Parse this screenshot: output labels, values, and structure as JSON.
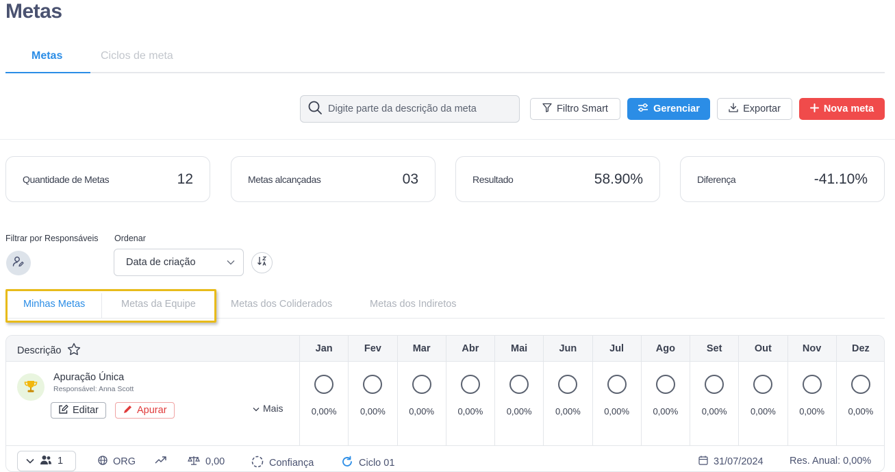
{
  "page": {
    "title": "Metas"
  },
  "top_tabs": [
    {
      "label": "Metas",
      "active": true
    },
    {
      "label": "Ciclos de meta",
      "active": false
    }
  ],
  "toolbar": {
    "search_placeholder": "Digite parte da descrição da meta",
    "filter_label": "Filtro Smart",
    "manage_label": "Gerenciar",
    "export_label": "Exportar",
    "new_label": "Nova meta"
  },
  "stats": [
    {
      "label": "Quantidade de Metas",
      "value": "12"
    },
    {
      "label": "Metas alcançadas",
      "value": "03"
    },
    {
      "label": "Resultado",
      "value": "58.90%"
    },
    {
      "label": "Diferença",
      "value": "-41.10%"
    }
  ],
  "filters": {
    "responsaveis_label": "Filtrar por Responsáveis",
    "order_label": "Ordenar",
    "order_value": "Data de criação"
  },
  "sub_tabs": [
    {
      "label": "Minhas Metas",
      "active": true
    },
    {
      "label": "Metas da Equipe",
      "active": false
    },
    {
      "label": "Metas dos Coliderados",
      "active": false
    },
    {
      "label": "Metas dos Indiretos",
      "active": false
    }
  ],
  "table": {
    "desc_header": "Descrição",
    "months": [
      "Jan",
      "Fev",
      "Mar",
      "Abr",
      "Mai",
      "Jun",
      "Jul",
      "Ago",
      "Set",
      "Out",
      "Nov",
      "Dez"
    ],
    "rows": [
      {
        "title": "Apuração Única",
        "responsible": "Responsável: Anna Scott",
        "edit_label": "Editar",
        "apurar_label": "Apurar",
        "more_label": "Mais",
        "values": [
          "0,00%",
          "0,00%",
          "0,00%",
          "0,00%",
          "0,00%",
          "0,00%",
          "0,00%",
          "0,00%",
          "0,00%",
          "0,00%",
          "0,00%",
          "0,00%"
        ],
        "footer": {
          "people_count": "1",
          "org": "ORG",
          "weight": "0,00",
          "confidence": "Confiança",
          "cycle": "Ciclo 01",
          "date": "31/07/2024",
          "annual": "Res. Anual: 0,00%"
        }
      }
    ]
  },
  "colors": {
    "accent": "#2b8de6",
    "danger": "#f04b4b",
    "highlight": "#e8bb1a"
  }
}
